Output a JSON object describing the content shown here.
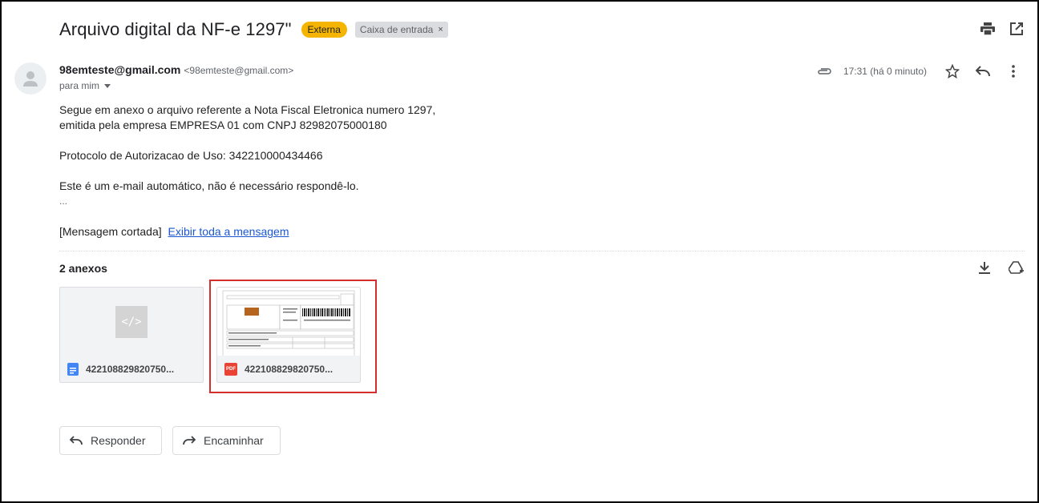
{
  "email": {
    "subject": "Arquivo digital da NF-e 1297\"",
    "badge": "Externa",
    "label_chip": "Caixa de entrada",
    "label_chip_close": "×",
    "sender_name": "98emteste@gmail.com",
    "sender_email": "<98emteste@gmail.com>",
    "to_label": "para mim",
    "time": "17:31 (há 0 minuto)",
    "body": {
      "line1": "Segue em anexo o arquivo referente a Nota Fiscal Eletronica numero 1297,",
      "line2": "emitida pela empresa EMPRESA 01 com CNPJ 82982075000180",
      "line3": "Protocolo de Autorizacao de Uso: 342210000434466",
      "line4": "Este é um e-mail automático, não é necessário respondê-lo.",
      "ellipsis": "...",
      "truncated": "[Mensagem cortada]",
      "show_all": "Exibir toda a mensagem"
    }
  },
  "attachments": {
    "header": "2 anexos",
    "items": [
      {
        "name": "422108829820750...",
        "type": "xml",
        "code_glyph": "</>",
        "corner_color": "#4285f4"
      },
      {
        "name": "422108829820750...",
        "type": "pdf",
        "pdf_label": "PDF",
        "corner_color": "#ea4335"
      }
    ]
  },
  "actions": {
    "reply": "Responder",
    "forward": "Encaminhar"
  },
  "colors": {
    "badge": "#f4b400",
    "link": "#1a57cf",
    "highlight": "#d32f2f"
  }
}
